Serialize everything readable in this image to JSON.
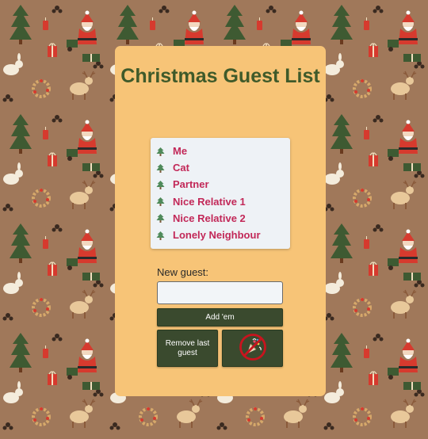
{
  "page": {
    "title": "Christmas Guest List"
  },
  "guests": [
    "Me",
    "Cat",
    "Partner",
    "Nice Relative 1",
    "Nice Relative 2",
    "Lonely Neighbour"
  ],
  "form": {
    "new_guest_label": "New guest:",
    "input_value": "",
    "add_label": "Add 'em",
    "remove_label": "Remove last guest",
    "clear_icon": "no-party-icon"
  },
  "colors": {
    "background": "#a0785a",
    "card": "#f7c477",
    "title": "#3f5a2a",
    "guest_name": "#c22858",
    "button": "#3a4a2e",
    "list_bg": "#eef2f6"
  }
}
